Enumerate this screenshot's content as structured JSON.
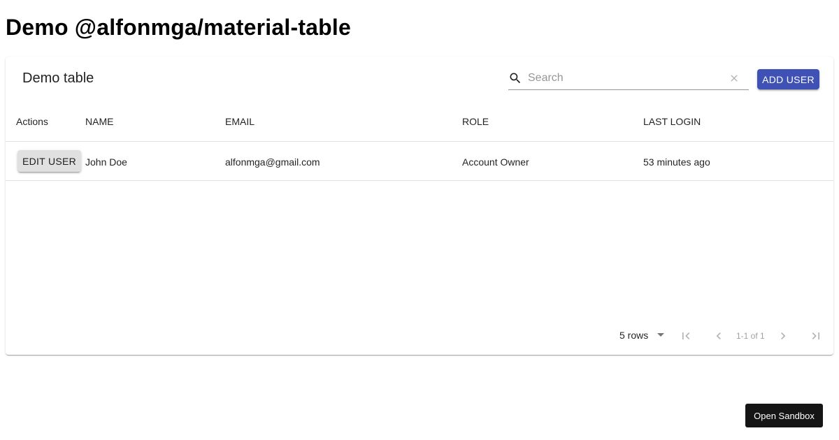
{
  "page": {
    "title": "Demo @alfonmga/material-table"
  },
  "table": {
    "title": "Demo table",
    "search": {
      "placeholder": "Search",
      "value": ""
    },
    "add_user_label": "ADD USER",
    "columns": [
      "Actions",
      "NAME",
      "EMAIL",
      "ROLE",
      "LAST LOGIN"
    ],
    "rows": [
      {
        "action_label": "EDIT USER",
        "name": "John Doe",
        "email": "alfonmga@gmail.com",
        "role": "Account Owner",
        "last_login": "53 minutes ago"
      }
    ],
    "pagination": {
      "rows_per_page": "5 rows",
      "page_info": "1-1 of 1"
    }
  },
  "sandbox": {
    "label": "Open Sandbox"
  },
  "colors": {
    "primary": "#3f51b5",
    "sandbox_bg": "#151515"
  },
  "icons": [
    "search-icon",
    "clear-icon",
    "dropdown-arrow-icon",
    "first-page-icon",
    "previous-page-icon",
    "next-page-icon",
    "last-page-icon"
  ]
}
